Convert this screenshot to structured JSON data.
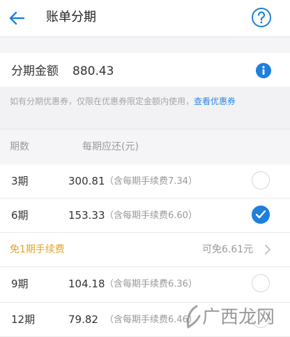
{
  "header": {
    "title": "账单分期",
    "back_icon": "arrow-left-icon",
    "help_icon": "question-circle-icon"
  },
  "amount": {
    "label": "分期金额",
    "value": "880.43",
    "info_icon": "info-icon"
  },
  "coupon": {
    "text": "如有分期优惠券，仅限在优惠券限定金额内使用，",
    "link": "查看优惠券"
  },
  "columns": {
    "term": "期数",
    "payment": "每期应还(元)"
  },
  "plans": [
    {
      "term": "3期",
      "amount": "300.81",
      "fee": "（含每期手续费7.34）",
      "selected": false
    },
    {
      "term": "6期",
      "amount": "153.33",
      "fee": "（含每期手续费6.60）",
      "selected": true
    },
    {
      "term": "9期",
      "amount": "104.18",
      "fee": "（含每期手续费6.36）",
      "selected": false
    },
    {
      "term": "12期",
      "amount": "79.82",
      "fee": "（含每期手续费6.46）",
      "selected": false
    }
  ],
  "promo": {
    "label": "免1期手续费",
    "value": "可免6.61元"
  },
  "watermark": {
    "text": "广西龙网"
  },
  "colors": {
    "accent": "#1e7fdc",
    "promo": "#e0a52b",
    "link": "#2e8ae6"
  }
}
